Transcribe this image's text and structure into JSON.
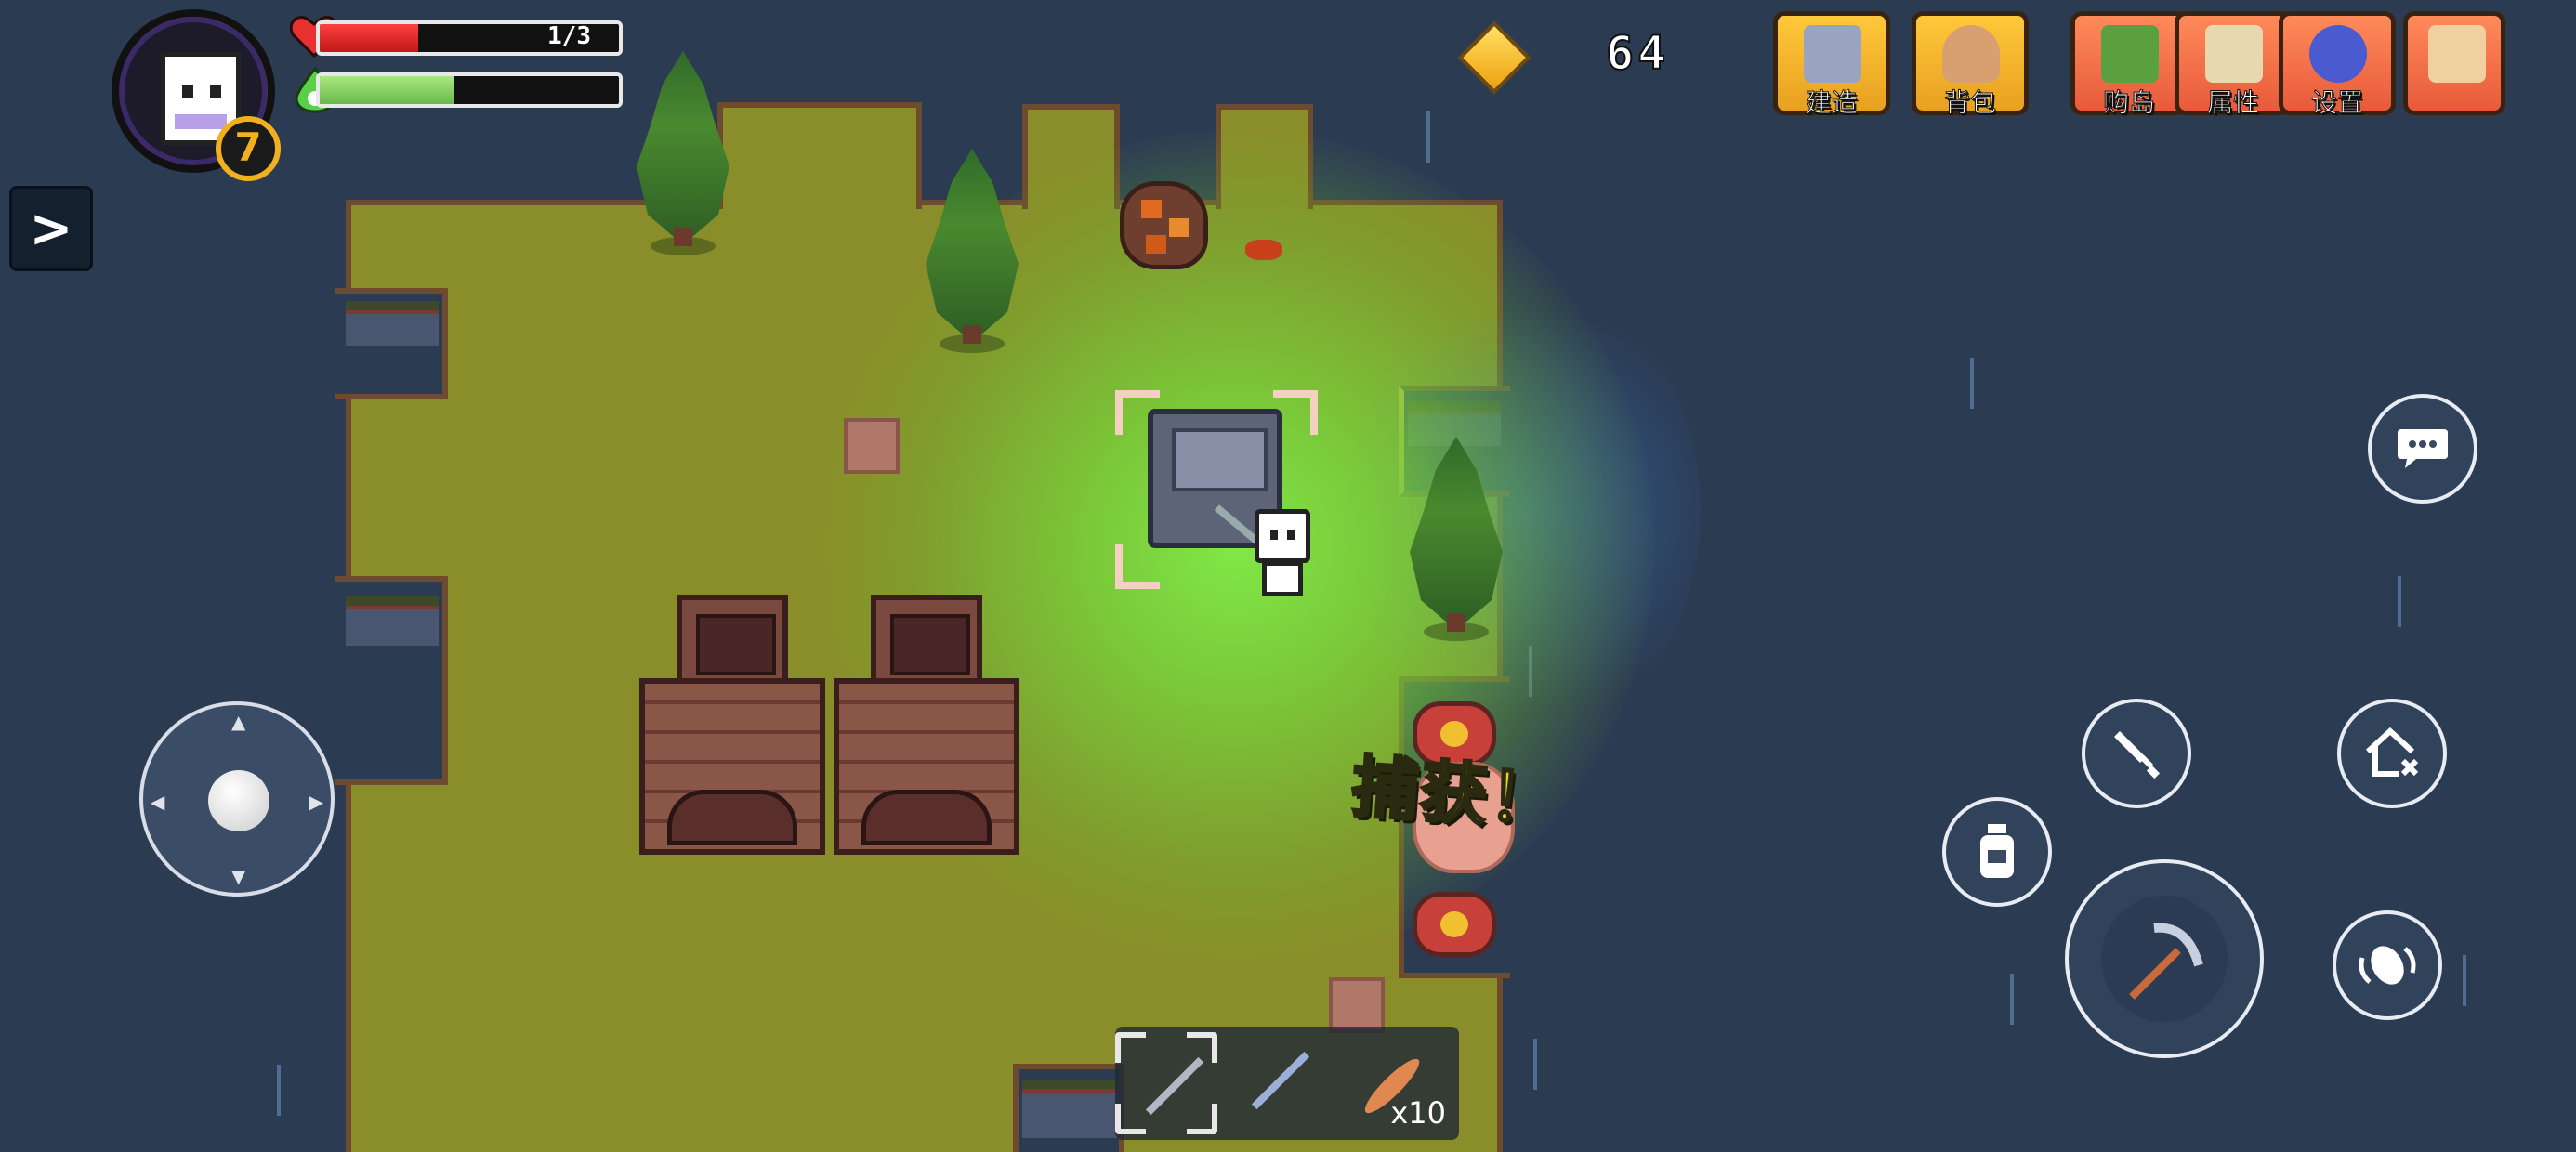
{
  "hud": {
    "level": "7",
    "health": {
      "text": "1/3",
      "fraction": 0.33
    },
    "energy": {
      "fraction": 0.45
    },
    "currency": {
      "icon": "gem-icon",
      "value": "64"
    }
  },
  "menu": [
    {
      "label": "建造",
      "icon": "build-icon"
    },
    {
      "label": "背包",
      "icon": "backpack-icon"
    },
    {
      "label": "购岛",
      "icon": "buy-island-icon"
    },
    {
      "label": "属性",
      "icon": "attributes-icon"
    },
    {
      "label": "设置",
      "icon": "settings-gear-icon"
    },
    {
      "label": "",
      "icon": "map-scroll-icon"
    }
  ],
  "world": {
    "popup_text": "捕获！"
  },
  "hotbar": {
    "slots": [
      {
        "item": "pickaxe",
        "selected": true
      },
      {
        "item": "shovel"
      },
      {
        "item": "fish",
        "count": "x10"
      }
    ]
  },
  "controls": {
    "chat": "chat-bubble-icon",
    "attack": "sword-icon",
    "home": "home-cancel-icon",
    "potion": "potion-icon",
    "action": "pickaxe-icon",
    "roll": "dodge-roll-icon"
  },
  "colors": {
    "sea": "#2b3b52",
    "grass": "#8a8e2a",
    "hp": "#e02424",
    "energy": "#8ad066",
    "gold": "#f0b020"
  }
}
